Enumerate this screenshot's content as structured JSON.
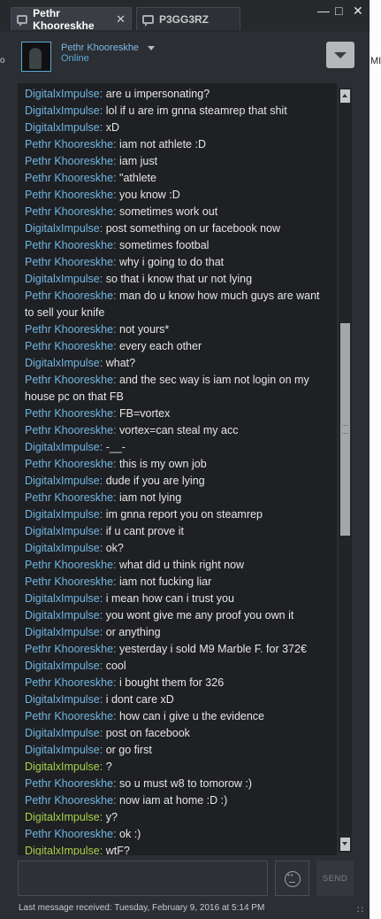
{
  "tabs": [
    {
      "label": "Pethr Khooreskhe",
      "active": true
    },
    {
      "label": "P3GG3RZ",
      "active": false
    }
  ],
  "window_controls": {
    "minimize": "—",
    "maximize": "□",
    "close": "✕"
  },
  "header": {
    "username": "Pethr Khooreskhe",
    "status": "Online"
  },
  "messages": [
    {
      "sender": "DigitalxImpulse",
      "text": "are u impersonating?",
      "color": "#6fb6e3"
    },
    {
      "sender": "DigitalxImpulse",
      "text": "lol if u are im gnna steamrep that shit",
      "color": "#6fb6e3"
    },
    {
      "sender": "DigitalxImpulse",
      "text": "xD",
      "color": "#6fb6e3"
    },
    {
      "sender": "Pethr Khooreskhe",
      "text": "iam not athlete :D",
      "color": "#6fb6e3"
    },
    {
      "sender": "Pethr Khooreskhe",
      "text": "iam just",
      "color": "#6fb6e3"
    },
    {
      "sender": "Pethr Khooreskhe",
      "text": "\"athlete",
      "color": "#6fb6e3"
    },
    {
      "sender": "Pethr Khooreskhe",
      "text": "you know :D",
      "color": "#6fb6e3"
    },
    {
      "sender": "Pethr Khooreskhe",
      "text": "sometimes work out",
      "color": "#6fb6e3"
    },
    {
      "sender": "DigitalxImpulse",
      "text": "post something on ur facebook now",
      "color": "#6fb6e3"
    },
    {
      "sender": "Pethr Khooreskhe",
      "text": "sometimes footbal",
      "color": "#6fb6e3"
    },
    {
      "sender": "Pethr Khooreskhe",
      "text": "why i going to do that",
      "color": "#6fb6e3"
    },
    {
      "sender": "DigitalxImpulse",
      "text": "so that i know that ur not lying",
      "color": "#6fb6e3"
    },
    {
      "sender": "Pethr Khooreskhe",
      "text": "man do u know how much guys are want to sell your knife",
      "color": "#6fb6e3"
    },
    {
      "sender": "Pethr Khooreskhe",
      "text": "not yours*",
      "color": "#6fb6e3"
    },
    {
      "sender": "Pethr Khooreskhe",
      "text": "every each other",
      "color": "#6fb6e3"
    },
    {
      "sender": "DigitalxImpulse",
      "text": "what?",
      "color": "#6fb6e3"
    },
    {
      "sender": "Pethr Khooreskhe",
      "text": "and the sec way is iam not login on my house pc on that FB",
      "color": "#6fb6e3"
    },
    {
      "sender": "Pethr Khooreskhe",
      "text": "FB=vortex",
      "color": "#6fb6e3"
    },
    {
      "sender": "Pethr Khooreskhe",
      "text": "vortex=can steal my acc",
      "color": "#6fb6e3"
    },
    {
      "sender": "DigitalxImpulse",
      "text": "-__-",
      "color": "#6fb6e3"
    },
    {
      "sender": "Pethr Khooreskhe",
      "text": "this is my own job",
      "color": "#6fb6e3"
    },
    {
      "sender": "DigitalxImpulse",
      "text": "dude if you are lying",
      "color": "#6fb6e3"
    },
    {
      "sender": "Pethr Khooreskhe",
      "text": "iam not lying",
      "color": "#6fb6e3"
    },
    {
      "sender": "DigitalxImpulse",
      "text": "im gnna report  you on steamrep",
      "color": "#6fb6e3"
    },
    {
      "sender": "DigitalxImpulse",
      "text": "if u cant prove it",
      "color": "#6fb6e3"
    },
    {
      "sender": "DigitalxImpulse",
      "text": "ok?",
      "color": "#6fb6e3"
    },
    {
      "sender": "Pethr Khooreskhe",
      "text": "what did u think right now",
      "color": "#6fb6e3"
    },
    {
      "sender": "Pethr Khooreskhe",
      "text": "iam not fucking liar",
      "color": "#6fb6e3"
    },
    {
      "sender": "DigitalxImpulse",
      "text": "i mean how can i trust you",
      "color": "#6fb6e3"
    },
    {
      "sender": "DigitalxImpulse",
      "text": "you wont give me any proof you own it",
      "color": "#6fb6e3"
    },
    {
      "sender": "DigitalxImpulse",
      "text": "or anything",
      "color": "#6fb6e3"
    },
    {
      "sender": "Pethr Khooreskhe",
      "text": "yesterday i sold M9 Marble F. for 372€",
      "color": "#6fb6e3"
    },
    {
      "sender": "DigitalxImpulse",
      "text": "cool",
      "color": "#6fb6e3"
    },
    {
      "sender": "Pethr Khooreskhe",
      "text": "i bought them for 326",
      "color": "#6fb6e3"
    },
    {
      "sender": "DigitalxImpulse",
      "text": "i dont care xD",
      "color": "#6fb6e3"
    },
    {
      "sender": "Pethr Khooreskhe",
      "text": "how can i give u the evidence",
      "color": "#6fb6e3"
    },
    {
      "sender": "DigitalxImpulse",
      "text": "post on facebook",
      "color": "#6fb6e3"
    },
    {
      "sender": "DigitalxImpulse",
      "text": "or go first",
      "color": "#6fb6e3"
    },
    {
      "sender": "DigitalxImpulse",
      "text": "?",
      "color": "#a9d34a"
    },
    {
      "sender": "Pethr Khooreskhe",
      "text": "so u must w8 to tomorow :)",
      "color": "#6fb6e3"
    },
    {
      "sender": "Pethr Khooreskhe",
      "text": "now iam at home :D :)",
      "color": "#6fb6e3"
    },
    {
      "sender": "DigitalxImpulse",
      "text": "y?",
      "color": "#a9d34a"
    },
    {
      "sender": "Pethr Khooreskhe",
      "text": "ok :)",
      "color": "#6fb6e3"
    },
    {
      "sender": "DigitalxImpulse",
      "text": "wtF?",
      "color": "#a9d34a"
    }
  ],
  "composer": {
    "input_value": "",
    "emoji_icon": "smiley-icon",
    "send_label": "SEND"
  },
  "footer": {
    "last_message": "Last message received: Tuesday, February 9, 2016 at 5:14 PM"
  },
  "background_window": {
    "left_fragment": "o",
    "right_fragment": "MI"
  },
  "colors": {
    "sender_blue": "#6fb6e3",
    "sender_green": "#a9d34a",
    "window_bg": "#2b2e33",
    "chat_bg": "#1f2023"
  }
}
